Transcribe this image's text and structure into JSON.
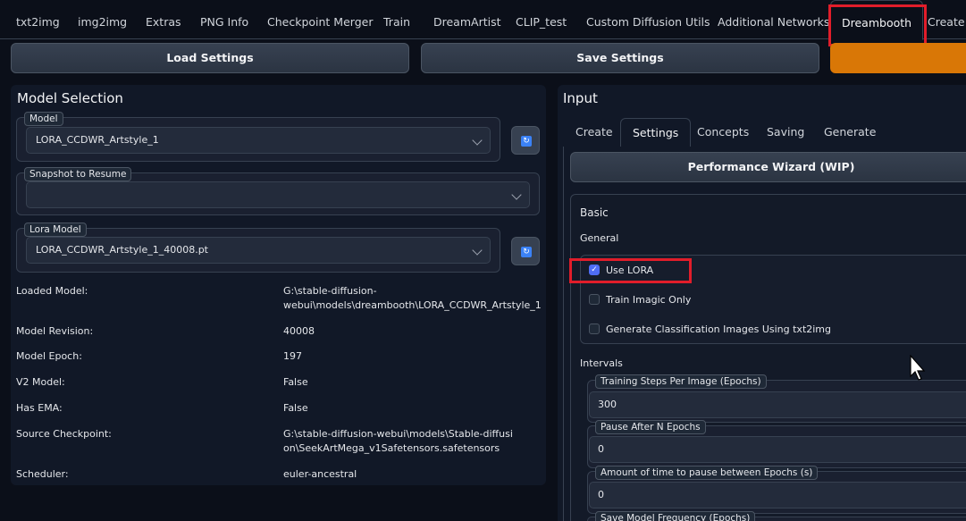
{
  "tabs": [
    {
      "label": "txt2img"
    },
    {
      "label": "img2img"
    },
    {
      "label": "Extras"
    },
    {
      "label": "PNG Info"
    },
    {
      "label": "Checkpoint Merger"
    },
    {
      "label": "Train"
    },
    {
      "label": "DreamArtist"
    },
    {
      "label": "CLIP_test"
    },
    {
      "label": "Custom Diffusion Utils"
    },
    {
      "label": "Additional Networks"
    },
    {
      "label": "Dreambooth"
    },
    {
      "label": "Create a"
    }
  ],
  "toolbar": {
    "load_label": "Load Settings",
    "save_label": "Save Settings",
    "third_label": ""
  },
  "model_selection": {
    "title": "Model Selection",
    "model": {
      "label": "Model",
      "value": "LORA_CCDWR_Artstyle_1"
    },
    "snapshot": {
      "label": "Snapshot to Resume",
      "value": ""
    },
    "lora": {
      "label": "Lora Model",
      "value": "LORA_CCDWR_Artstyle_1_40008.pt"
    },
    "info": [
      {
        "key": "Loaded Model:",
        "value": "G:\\stable-diffusion-webui\\models\\dreambooth\\LORA_CCDWR_Artstyle_1"
      },
      {
        "key": "Model Revision:",
        "value": "40008"
      },
      {
        "key": "Model Epoch:",
        "value": "197"
      },
      {
        "key": "V2 Model:",
        "value": "False"
      },
      {
        "key": "Has EMA:",
        "value": "False"
      },
      {
        "key": "Source Checkpoint:",
        "value": "G:\\stable-diffusion-webui\\models\\Stable-diffusion\\SeekArtMega_v1Safetensors.safetensors"
      },
      {
        "key": "Scheduler:",
        "value": "euler-ancestral"
      }
    ]
  },
  "input": {
    "title": "Input",
    "subtabs": [
      {
        "label": "Create"
      },
      {
        "label": "Settings"
      },
      {
        "label": "Concepts"
      },
      {
        "label": "Saving"
      },
      {
        "label": "Generate"
      }
    ],
    "wizard_label": "Performance Wizard (WIP)",
    "basic_title": "Basic",
    "general_title": "General",
    "checks": [
      {
        "label": "Use LORA",
        "checked": true
      },
      {
        "label": "Train Imagic Only",
        "checked": false
      },
      {
        "label": "Generate Classification Images Using txt2img",
        "checked": false
      }
    ],
    "intervals_title": "Intervals",
    "fields": [
      {
        "label": "Training Steps Per Image (Epochs)",
        "value": "300"
      },
      {
        "label": "Pause After N Epochs",
        "value": "0"
      },
      {
        "label": "Amount of time to pause between Epochs (s)",
        "value": "0"
      },
      {
        "label": "Save Model Frequency (Epochs)",
        "value": ""
      }
    ]
  },
  "colors": {
    "accent_orange": "#d97706",
    "highlight_red": "#e11d2a",
    "checkbox_blue": "#4f6df5",
    "background": "#0b0f19"
  }
}
